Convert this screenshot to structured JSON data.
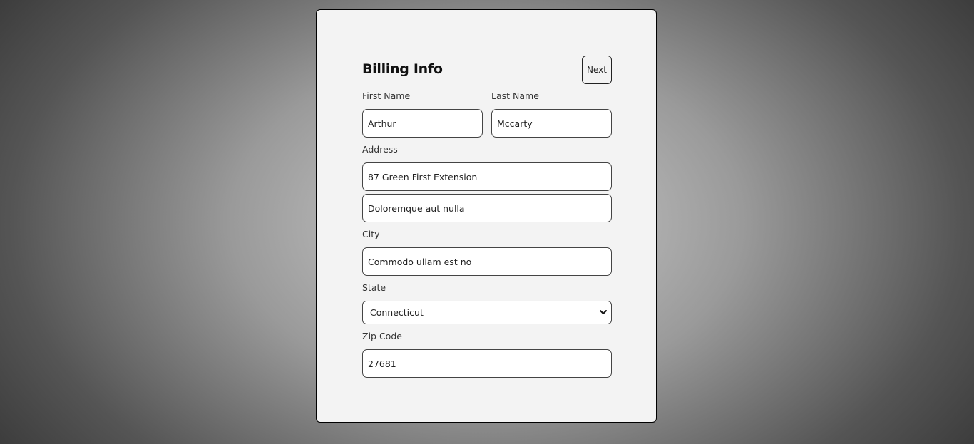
{
  "form": {
    "title": "Billing Info",
    "next_label": "Next",
    "first_name": {
      "label": "First Name",
      "value": "Arthur"
    },
    "last_name": {
      "label": "Last Name",
      "value": "Mccarty"
    },
    "address": {
      "label": "Address",
      "line1": "87 Green First Extension",
      "line2": "Doloremque aut nulla"
    },
    "city": {
      "label": "City",
      "value": "Commodo ullam est no"
    },
    "state": {
      "label": "State",
      "selected": "Connecticut"
    },
    "zip": {
      "label": "Zip Code",
      "value": "27681"
    }
  },
  "icons": {
    "state_dropdown": "chevron-down-icon"
  },
  "colors": {
    "card_background": "#f3f3f3",
    "border": "#444444"
  }
}
